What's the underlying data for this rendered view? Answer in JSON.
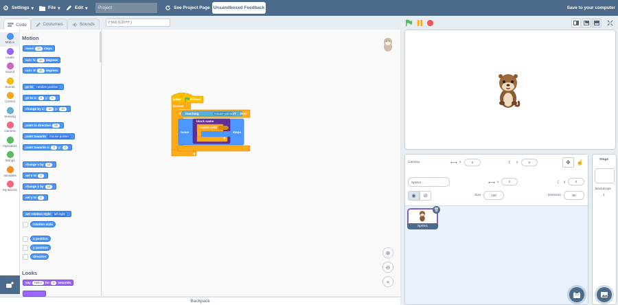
{
  "menubar": {
    "settings": "Settings",
    "file": "File",
    "edit": "Edit",
    "project_title": "Project",
    "see_project_page": "See Project Page",
    "feedback": "Unsandboxed Feedback",
    "save": "Save to your computer"
  },
  "tabs": {
    "code": "Code",
    "costumes": "Costumes",
    "sounds": "Sounds"
  },
  "search": {
    "placeholder": "Find (Ctrl+F)"
  },
  "categories": [
    {
      "label": "Motion",
      "color": "#4c97ff"
    },
    {
      "label": "Looks",
      "color": "#9966ff"
    },
    {
      "label": "Sound",
      "color": "#cf63cf"
    },
    {
      "label": "Events",
      "color": "#ffbf00"
    },
    {
      "label": "Control",
      "color": "#ffab19"
    },
    {
      "label": "Sensing",
      "color": "#5cb1d6"
    },
    {
      "label": "Camera",
      "color": "#ff6680"
    },
    {
      "label": "Operators",
      "color": "#59c059"
    },
    {
      "label": "Strings",
      "color": "#59c059"
    },
    {
      "label": "Variables",
      "color": "#ff8c1a"
    },
    {
      "label": "My Blocks",
      "color": "#ff6680"
    }
  ],
  "palette": {
    "motion_title": "Motion",
    "looks_title": "Looks",
    "blocks": {
      "move_a": "move",
      "move_v": "10",
      "move_b": "steps",
      "turn1_a": "turn",
      "turn1_v": "15",
      "turn1_b": "degrees",
      "turn2_a": "turn",
      "turn2_v": "15",
      "turn2_b": "degrees",
      "goto_a": "go to",
      "goto_dd": "random position",
      "gotoxy_a": "go to x:",
      "gotoxy_x": "0",
      "gotoxy_b": "y:",
      "gotoxy_y": "0",
      "chx_a": "change by x:",
      "chx_x": "10",
      "chx_b": "y:",
      "chx_y": "10",
      "pdir_a": "point in direction",
      "pdir_v": "90",
      "ptow_a": "point towards",
      "ptow_dd": "mouse-pointer",
      "ptowxy_a": "point towards x:",
      "ptowxy_x": "0",
      "ptowxy_b": "y:",
      "ptowxy_y": "0",
      "cx_a": "change x by",
      "cx_v": "10",
      "sx_a": "set x to",
      "sx_v": "0",
      "cy_a": "change y by",
      "cy_v": "10",
      "sy_a": "set y to",
      "sy_v": "0",
      "rs_a": "set rotation style",
      "rs_dd": "left-right",
      "rs_rep": "rotation style",
      "xpos": "x position",
      "ypos": "y position",
      "dir": "direction",
      "say_a": "say",
      "say_v": "Hello!",
      "say_b": "for",
      "say_n": "2",
      "say_c": "seconds"
    }
  },
  "script": {
    "hat_a": "when",
    "hat_b": "clicked",
    "forever": "forever",
    "if": "if",
    "touching": "touching",
    "touching_dd": "mouse-pointer",
    "q": "?",
    "then": "then",
    "move": "move",
    "steps": "steps",
    "block_name": "block name",
    "repeat_until": "repeat until"
  },
  "stage_info": {
    "camera": "Camera",
    "cam_x": "0",
    "cam_y": "0",
    "sprite_name": "Sprite1",
    "x_label": "x",
    "y_label": "y",
    "x": "0",
    "y": "0",
    "size_label": "Size",
    "size": "100",
    "direction_label": "Direction",
    "direction": "90",
    "sprite_thumb_label": "Sprite1"
  },
  "stage_pane": {
    "title": "Stage",
    "backdrops_label": "Backdrops",
    "backdrops_count": "1"
  },
  "backpack": "Backpack",
  "colors": {
    "menubar": "#4c6b8a",
    "motion": "#4c97ff",
    "looks": "#9966ff",
    "control": "#ffab19",
    "events": "#ffbf00",
    "sensing": "#5cb1d6"
  }
}
